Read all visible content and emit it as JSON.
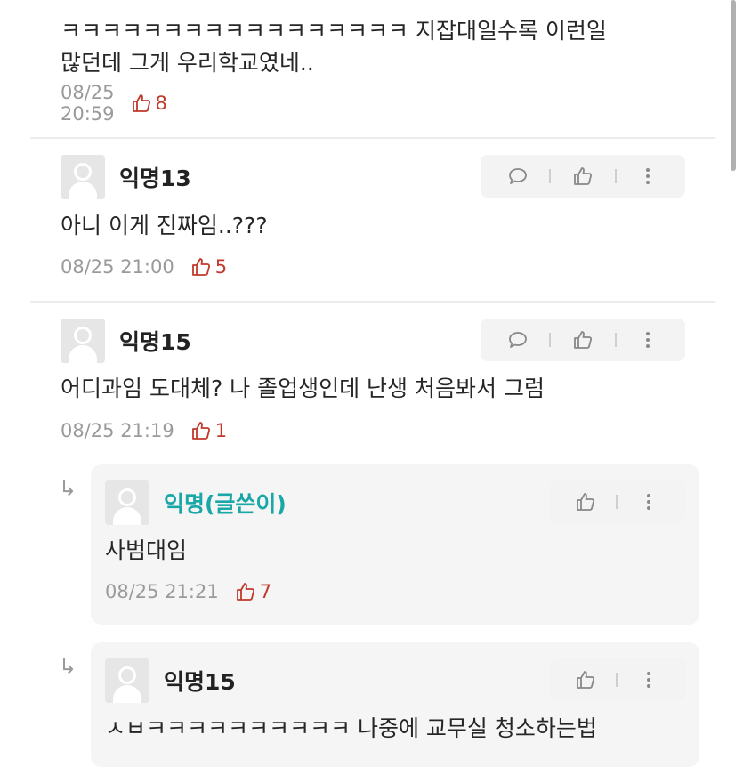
{
  "comments": [
    {
      "text_line1": "ㅋㅋㅋㅋㅋㅋㅋㅋㅋㅋㅋㅋㅋㅋㅋㅋㅋ 지잡대일수록 이런일",
      "text_line2": "많던데 그게 우리학교였네..",
      "time": "08/25 20:59",
      "likes": "8"
    },
    {
      "name": "익명13",
      "text": "아니 이게 진짜임..???",
      "time": "08/25 21:00",
      "likes": "5"
    },
    {
      "name": "익명15",
      "text": "어디과임 도대체? 나 졸업생인데 난생 처음봐서 그럼",
      "time": "08/25 21:19",
      "likes": "1"
    }
  ],
  "replies": [
    {
      "name": "익명(글쓴이)",
      "text": "사범대임",
      "time": "08/25 21:21",
      "likes": "7"
    },
    {
      "name": "익명15",
      "text": "ㅅㅂㅋㅋㅋㅋㅋㅋㅋㅋㅋㅋ 나중에 교무실 청소하는법"
    }
  ],
  "colors": {
    "like": "#c0392b",
    "op_name": "#1aa7a8",
    "meta": "#9a9a9a"
  },
  "icons": {
    "reply": "speech-bubble-icon",
    "like": "thumbs-up-icon",
    "more": "vertical-dots-icon"
  }
}
